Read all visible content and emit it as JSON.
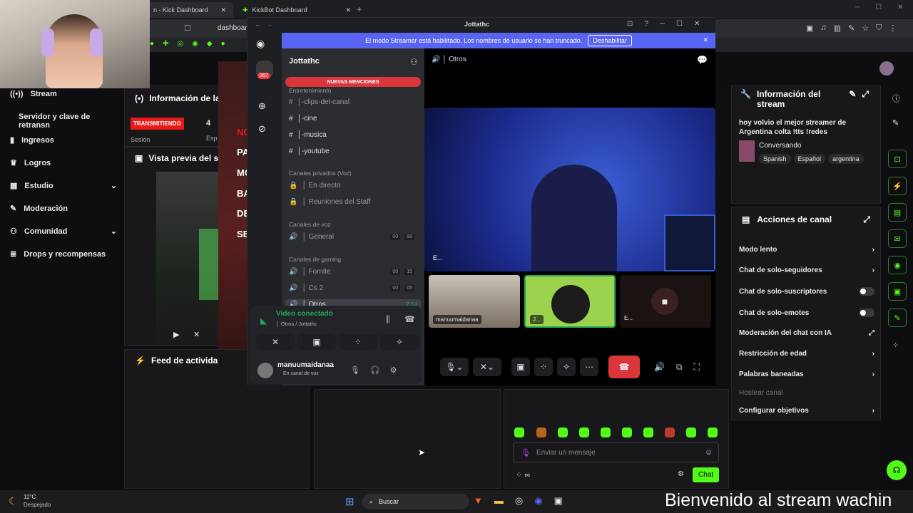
{
  "browser": {
    "tab1": "n - Kick Dashboard",
    "tab2": "KickBot Dashboard",
    "url": "dashboard"
  },
  "kick": {
    "nav": [
      "Stream",
      "Servidor y clave de retransn",
      "Ingresos",
      "Logros",
      "Estudio",
      "Moderación",
      "Comunidad",
      "Drops y recompensas"
    ],
    "info_title": "Información de la",
    "live_badge": "TRANSMITIENDO",
    "session_label": "Sesión",
    "session_value": "4",
    "esp_label": "Esp",
    "preview_title": "Vista previa del s",
    "feed_title": "Feed de activida",
    "stream_info_title": "Información del stream",
    "stream_title": "hoy volvio el mejor streamer de Argentina colta !tts !redes",
    "category": "Conversando",
    "tags": [
      "Spanish",
      "Español",
      "argentina"
    ],
    "actions_title": "Acciones de canal",
    "actions": [
      {
        "label": "Modo lento",
        "kind": "chevron"
      },
      {
        "label": "Chat de solo-seguidores",
        "kind": "chevron"
      },
      {
        "label": "Chat de solo-suscriptores",
        "kind": "toggle"
      },
      {
        "label": "Chat de solo-emotes",
        "kind": "toggle"
      },
      {
        "label": "Moderación del chat con IA",
        "kind": "link"
      },
      {
        "label": "Restricción de edad",
        "kind": "chevron"
      },
      {
        "label": "Palabras baneadas",
        "kind": "chevron"
      },
      {
        "label": "Hostear canal",
        "kind": "disabled"
      },
      {
        "label": "Configurar objetivos",
        "kind": "chevron"
      }
    ],
    "chat_placeholder": "Enviar un mensaje",
    "chat_button": "Chat",
    "red_letters": [
      "NC",
      "PA",
      "MC",
      "BA",
      "DE",
      "SE"
    ]
  },
  "discord": {
    "window_title": "Jottathc",
    "streamer_banner": "El modo Streamer está habilitado. Los nombres de usuario se han truncado.",
    "disable_btn": "Deshabilitar",
    "server_name": "Jottathc",
    "mentions": "NUEVAS MENCIONES",
    "badge": "267",
    "cat_ent": "Entretenimiento",
    "channels_text": [
      "│-clips-del-canal",
      "│-cine",
      "│-musica",
      "│-youtube"
    ],
    "cat_private": "Canales privados (Voz)",
    "private": [
      "│ En directo",
      "│ Reuniones del Staff"
    ],
    "cat_voice": "Canales de voz",
    "general": "│ General",
    "general_count": [
      "00",
      "99"
    ],
    "cat_gaming": "Canales de gaming",
    "fornite": "│ Fornite",
    "fornite_count": [
      "00",
      "15"
    ],
    "cs2": "│ Cs 2",
    "cs2_count": [
      "00",
      "05"
    ],
    "otros": "│ Otros",
    "otros_time": "7:14",
    "video_status": "Video conectado",
    "video_sub": "│ Otros / Jottathc",
    "user_name": "manuumaidanaa",
    "user_status": "En canal de voz",
    "stage_header": "│ Otros",
    "main_tag": "E...",
    "tile1": "manuumaidanaa",
    "tile2": "J...",
    "tile3": "E..."
  },
  "taskbar": {
    "temp": "11°C",
    "weather": "Despejado",
    "search": "Buscar"
  },
  "overlay_text": "Bienvenido al stream wachin"
}
